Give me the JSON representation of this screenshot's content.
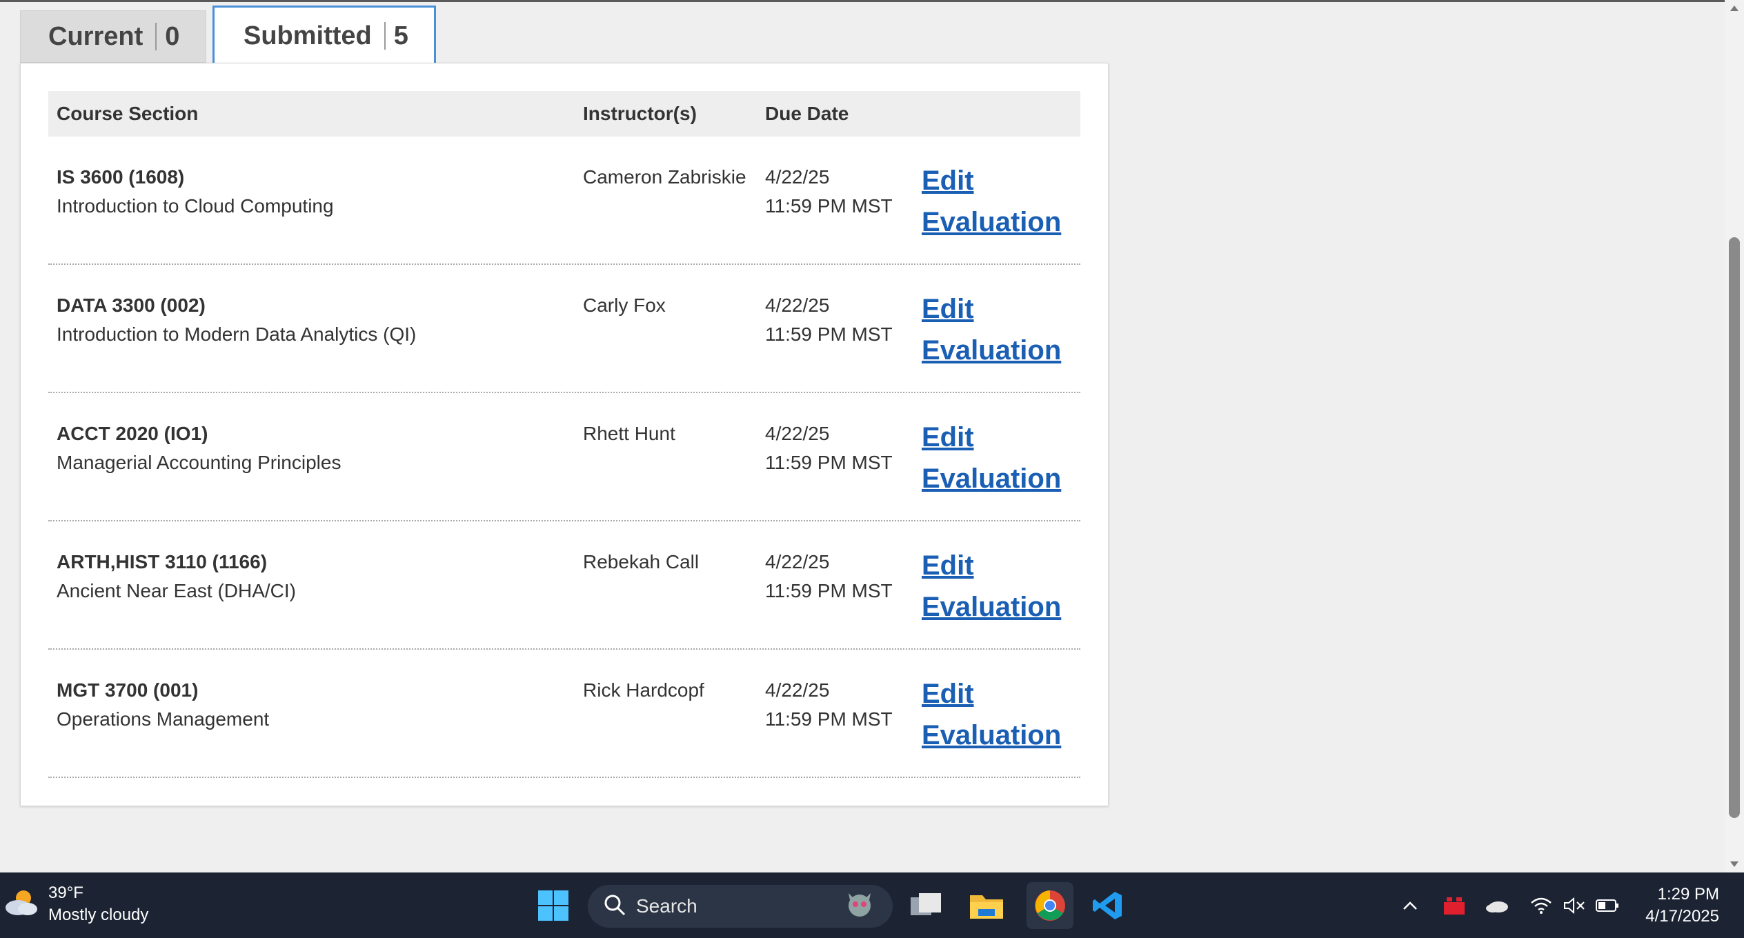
{
  "tabs": [
    {
      "label": "Current",
      "count": "0",
      "active": false
    },
    {
      "label": "Submitted",
      "count": "5",
      "active": true
    }
  ],
  "table": {
    "headers": [
      "Course Section",
      "Instructor(s)",
      "Due Date"
    ],
    "rows": [
      {
        "code": "IS 3600 (1608)",
        "title": "Introduction to Cloud Computing",
        "instructor": "Cameron Zabriskie",
        "due_date": "4/22/25",
        "due_time": "11:59 PM MST",
        "action_line1": "Edit",
        "action_line2": "Evaluation"
      },
      {
        "code": "DATA 3300 (002)",
        "title": "Introduction to Modern Data Analytics (QI)",
        "instructor": "Carly Fox",
        "due_date": "4/22/25",
        "due_time": "11:59 PM MST",
        "action_line1": "Edit",
        "action_line2": "Evaluation"
      },
      {
        "code": "ACCT 2020 (IO1)",
        "title": "Managerial Accounting Principles",
        "instructor": "Rhett Hunt",
        "due_date": "4/22/25",
        "due_time": "11:59 PM MST",
        "action_line1": "Edit",
        "action_line2": "Evaluation"
      },
      {
        "code": "ARTH,HIST 3110 (1166)",
        "title": "Ancient Near East (DHA/CI)",
        "instructor": "Rebekah Call",
        "due_date": "4/22/25",
        "due_time": "11:59 PM MST",
        "action_line1": "Edit",
        "action_line2": "Evaluation"
      },
      {
        "code": "MGT 3700 (001)",
        "title": "Operations Management",
        "instructor": "Rick Hardcopf",
        "due_date": "4/22/25",
        "due_time": "11:59 PM MST",
        "action_line1": "Edit",
        "action_line2": "Evaluation"
      }
    ]
  },
  "taskbar": {
    "weather_temp": "39°F",
    "weather_desc": "Mostly cloudy",
    "search_placeholder": "Search",
    "time": "1:29 PM",
    "date": "4/17/2025",
    "icons": [
      "windows-start-icon",
      "search-icon",
      "task-view-icon",
      "file-explorer-icon",
      "chrome-icon",
      "vscode-icon",
      "chevron-up-icon",
      "app-tray-icon",
      "onedrive-icon",
      "wifi-icon",
      "speaker-muted-icon",
      "battery-icon"
    ]
  },
  "colors": {
    "link": "#1a5fb4",
    "active_tab_border": "#4a90d9",
    "taskbar_bg": "#1c2433"
  }
}
